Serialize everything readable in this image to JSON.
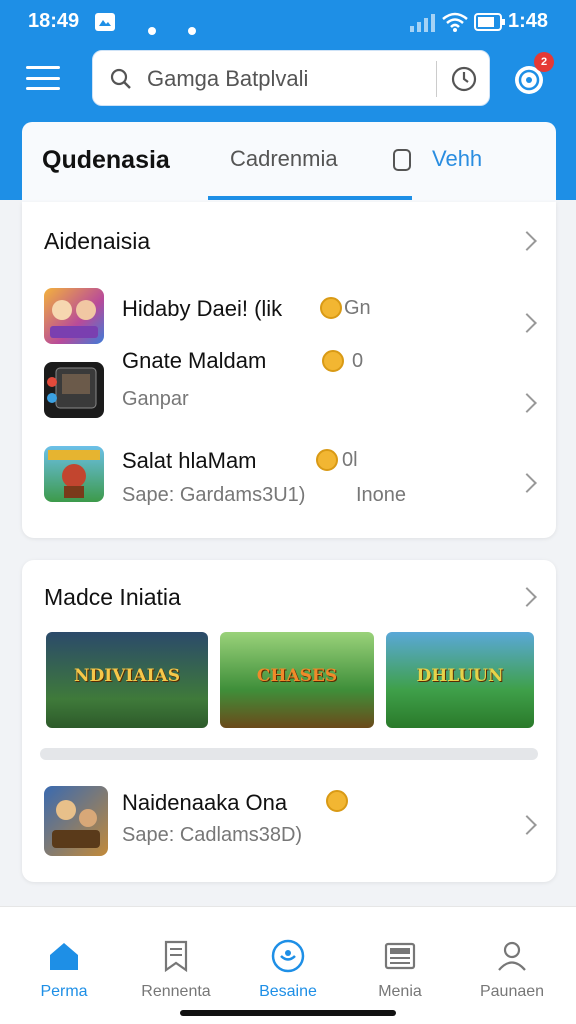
{
  "status_bar": {
    "time": "18:49",
    "right_time": "1:48"
  },
  "search": {
    "text": "Gamga Batplvali"
  },
  "notification": {
    "badge": "2"
  },
  "tabs": [
    {
      "label": "Qudenasia"
    },
    {
      "label": "Cadrenmia"
    },
    {
      "label": "Vehh"
    }
  ],
  "section1": {
    "title": "Aidenaisia",
    "apps": [
      {
        "name": "Hidaby Daei! (lik",
        "extra": "Gn",
        "sub": ""
      },
      {
        "name": "Gnate Maldam",
        "extra": "0",
        "sub": "Ganpar"
      },
      {
        "name": "Salat hlaMam",
        "extra": "0l",
        "sub": "Sape: Gardams3U1)",
        "sub2": "Inone"
      }
    ]
  },
  "section2": {
    "title": "Madce Iniatia",
    "banners": [
      {
        "label": "NDIVIAIAS"
      },
      {
        "label": "CHASES"
      },
      {
        "label": "DHLUUN"
      }
    ],
    "app": {
      "name": "Naidenaaka Ona",
      "sub": "Sape: Cadlams38D)"
    }
  },
  "bottom_nav": [
    {
      "label": "Perma",
      "icon": "home-icon"
    },
    {
      "label": "Rennenta",
      "icon": "bookmark-icon"
    },
    {
      "label": "Besaine",
      "icon": "game-controller-icon"
    },
    {
      "label": "Menia",
      "icon": "news-icon"
    },
    {
      "label": "Paunaen",
      "icon": "person-icon"
    }
  ],
  "colors": {
    "primary": "#1e8fe6",
    "badge": "#e53935",
    "coin": "#f2b632"
  }
}
